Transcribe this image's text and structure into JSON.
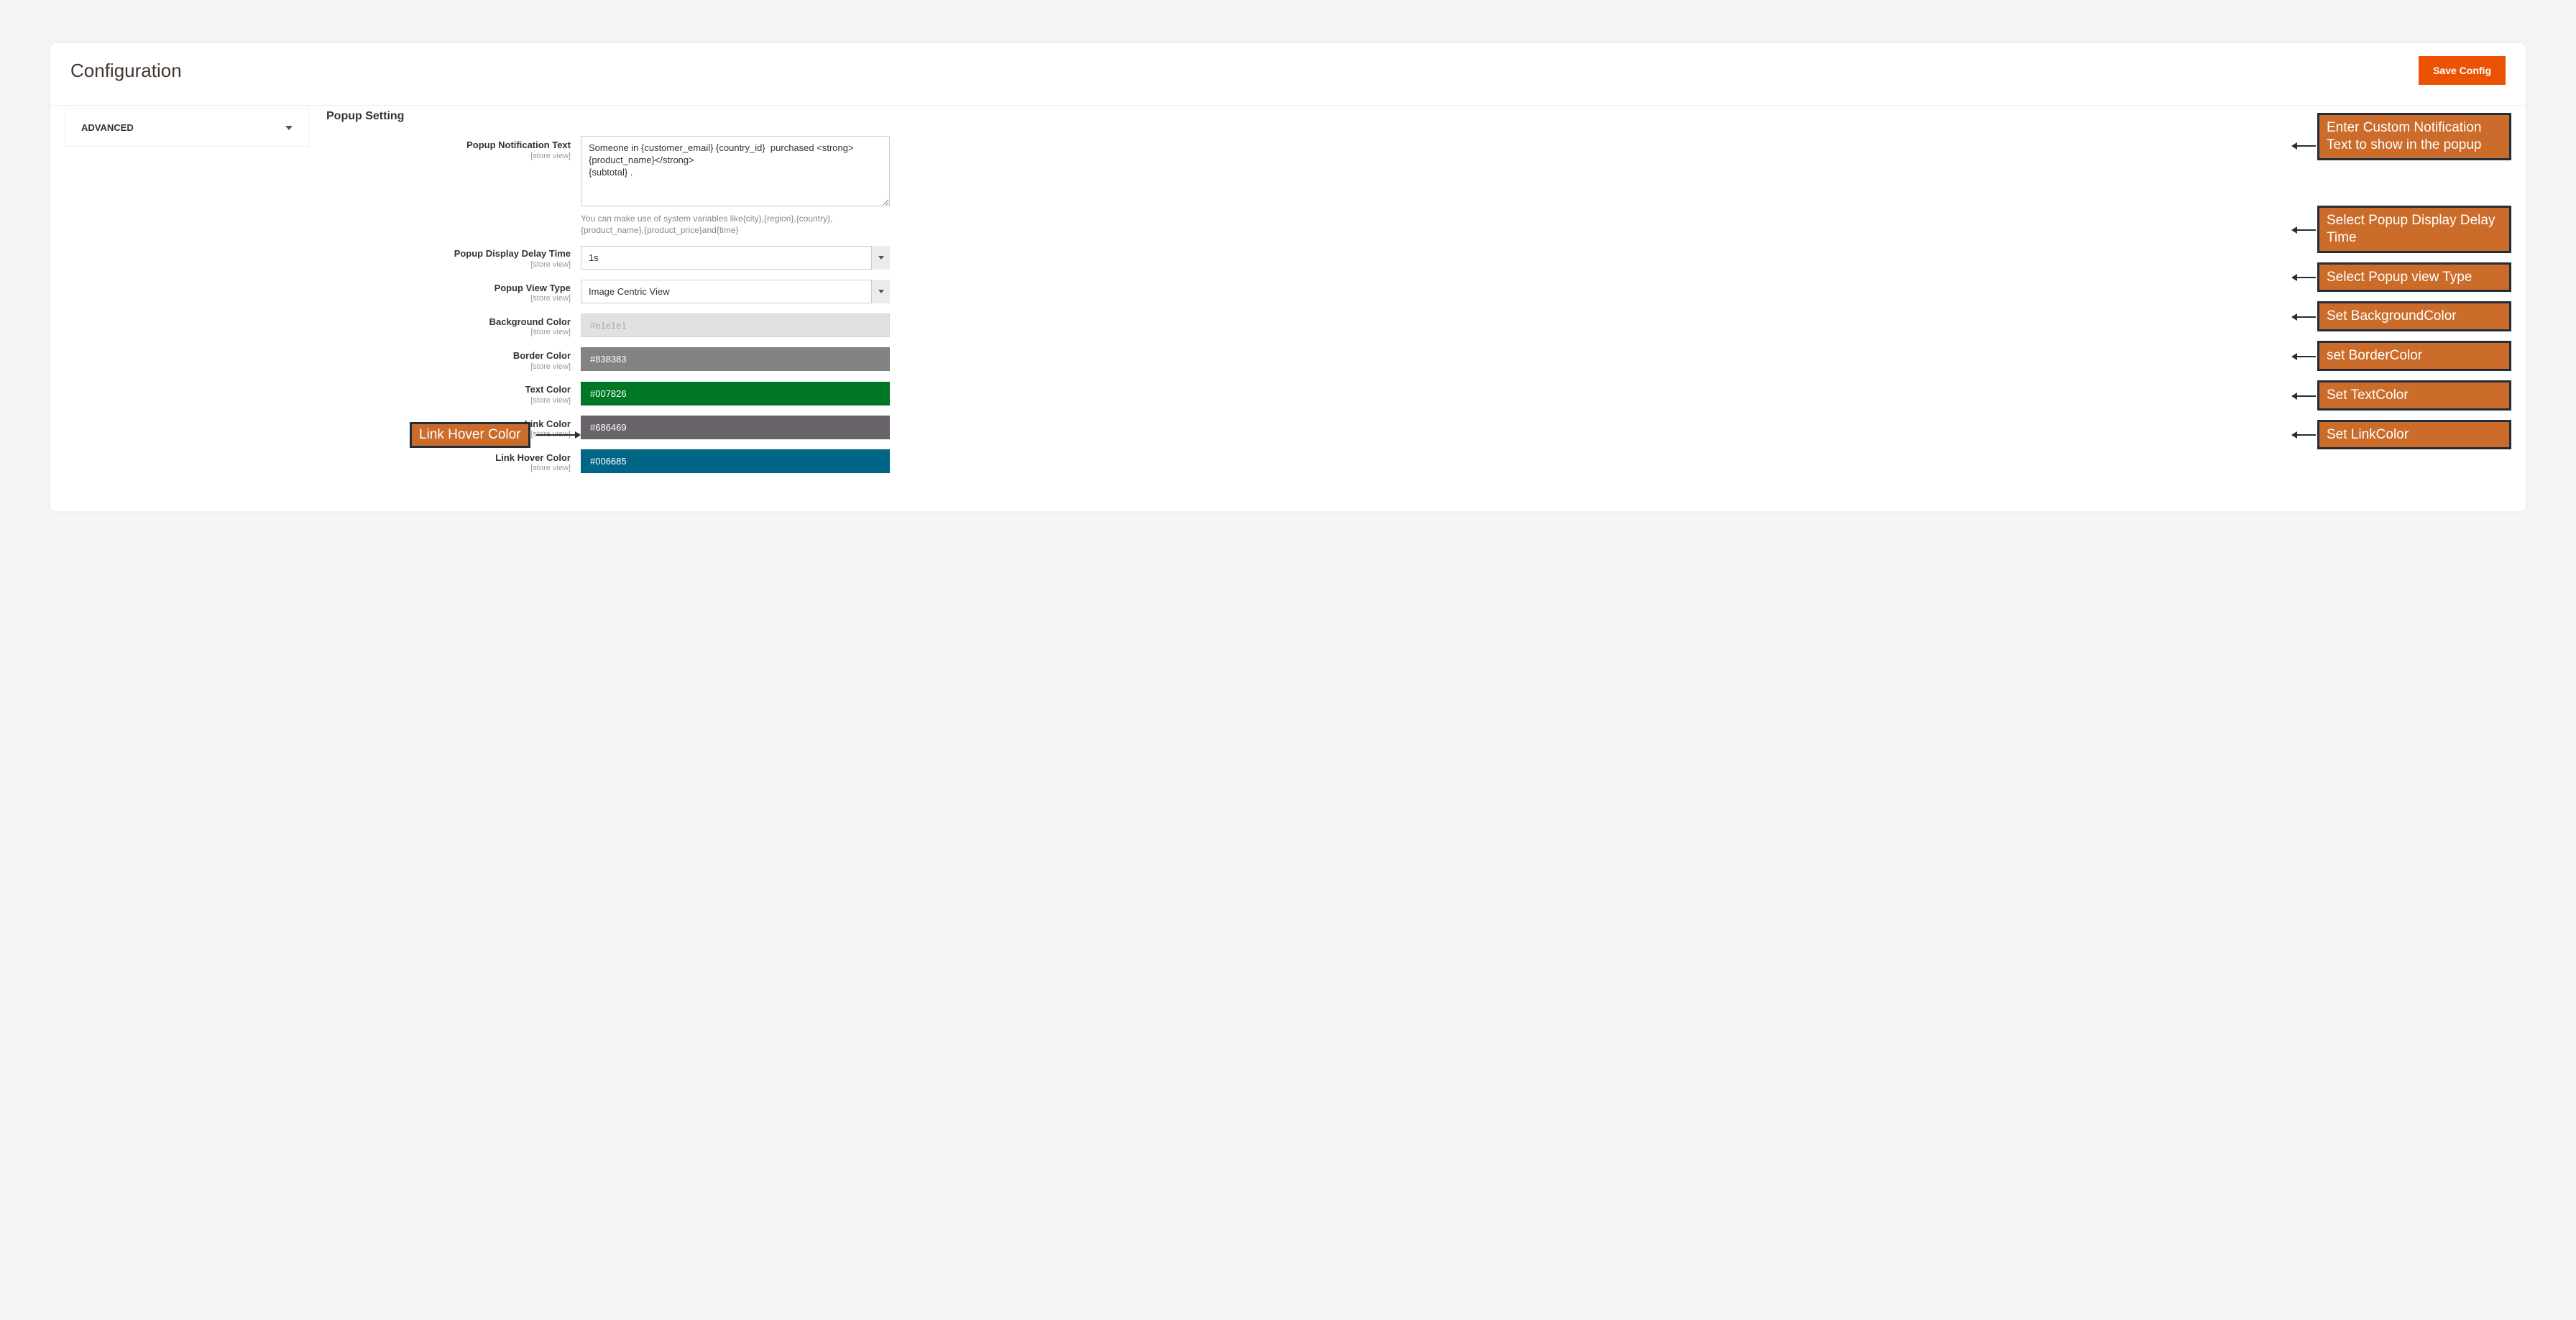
{
  "header": {
    "title": "Configuration",
    "save_label": "Save Config"
  },
  "sidebar": {
    "items": [
      {
        "label": "ADVANCED"
      }
    ]
  },
  "section": {
    "title": "Popup Setting"
  },
  "fields": {
    "notification_text": {
      "label": "Popup Notification Text",
      "scope": "[store view]",
      "value": "Someone in {customer_email} {country_id}  purchased <strong>{product_name}</strong>\n{subtotal} .",
      "help": "You can make use of system variables like{city},{region},{country},{product_name},{product_price}and{time}"
    },
    "delay_time": {
      "label": "Popup Display Delay Time",
      "scope": "[store view]",
      "value": "1s"
    },
    "view_type": {
      "label": "Popup View Type",
      "scope": "[store view]",
      "value": "Image Centric View"
    },
    "background_color": {
      "label": "Background Color",
      "scope": "[store view]",
      "value": "#e1e1e1",
      "hex": "#e1e1e1"
    },
    "border_color": {
      "label": "Border Color",
      "scope": "[store view]",
      "value": "#838383",
      "hex": "#838383"
    },
    "text_color": {
      "label": "Text Color",
      "scope": "[store view]",
      "value": "#007826",
      "hex": "#007826"
    },
    "link_color": {
      "label": "Link Color",
      "scope": "[store view]",
      "value": "#686469",
      "hex": "#686469"
    },
    "link_hover_color": {
      "label": "Link Hover Color",
      "scope": "[store view]",
      "value": "#006685",
      "hex": "#006685"
    }
  },
  "callouts": {
    "notification": "Enter Custom Notification Text to show  in the popup",
    "delay": "Select Popup Display Delay Time",
    "view_type": "Select Popup view Type",
    "background": "Set BackgroundColor",
    "border": "set BorderColor",
    "text_color": "Set TextColor",
    "link_color": "Set LinkColor",
    "link_hover": "Link Hover Color"
  }
}
